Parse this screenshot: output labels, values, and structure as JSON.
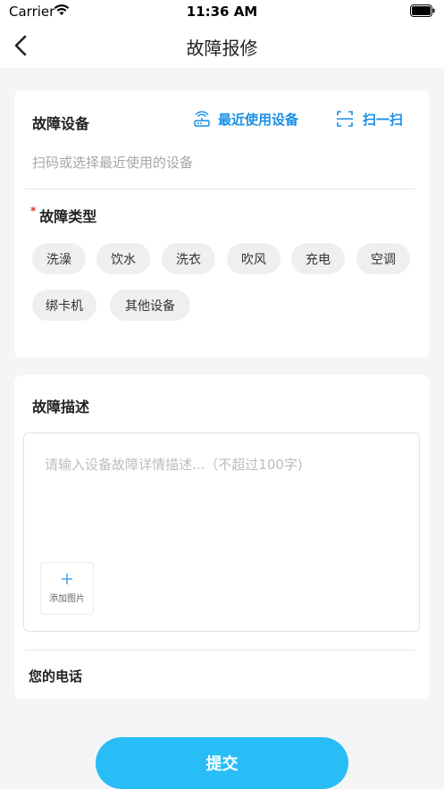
{
  "status_bar": {
    "carrier": "Carrier",
    "time": "11:36 AM"
  },
  "nav": {
    "title": "故障报修"
  },
  "device_section": {
    "label": "故障设备",
    "recent_label": "最近使用设备",
    "scan_label": "扫一扫",
    "placeholder": "扫码或选择最近使用的设备"
  },
  "fault_type": {
    "required_mark": "*",
    "label": "故障类型",
    "options": [
      "洗澡",
      "饮水",
      "洗衣",
      "吹风",
      "充电",
      "空调",
      "绑卡机",
      "其他设备"
    ]
  },
  "description": {
    "label": "故障描述",
    "placeholder": "请输入设备故障详情描述...（不超过100字)",
    "add_photo_label": "添加图片"
  },
  "phone": {
    "label": "您的电话"
  },
  "submit": {
    "label": "提交"
  },
  "colors": {
    "accent": "#1a8fe6",
    "button": "#29bdf7",
    "required": "#e5322d"
  }
}
